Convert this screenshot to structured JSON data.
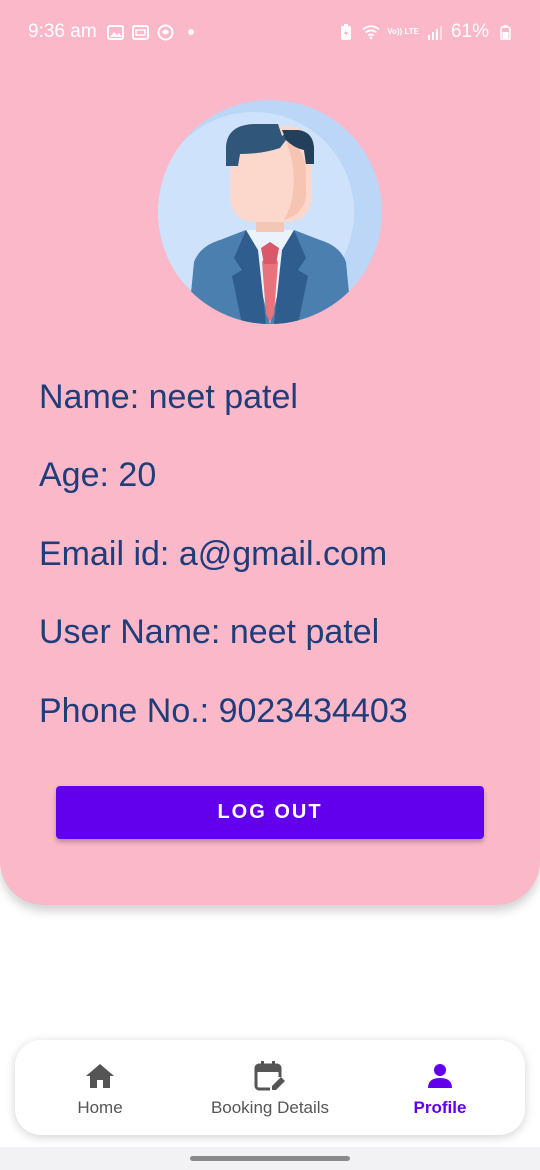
{
  "status_bar": {
    "time": "9:36 am",
    "battery": "61%",
    "network_label": "Vo)) LTE",
    "icons": [
      "gallery-icon",
      "cast-icon",
      "app-icon",
      "dot-icon",
      "battery-saver-icon",
      "wifi-icon",
      "signal-icon",
      "battery-icon"
    ]
  },
  "profile": {
    "avatar_icon": "businessman-avatar-icon",
    "name_label": "Name:",
    "name_value": "neet patel",
    "age_label": "Age:",
    "age_value": "20",
    "email_label": "Email id:",
    "email_value": "a@gmail.com",
    "username_label": "User Name:",
    "username_value": "neet patel",
    "phone_label": "Phone No.:",
    "phone_value": "9023434403",
    "logout_label": "LOG OUT"
  },
  "bottom_nav": {
    "items": [
      {
        "label": "Home",
        "icon": "home-icon",
        "active": false
      },
      {
        "label": "Booking Details",
        "icon": "calendar-edit-icon",
        "active": false
      },
      {
        "label": "Profile",
        "icon": "person-icon",
        "active": true
      }
    ]
  },
  "colors": {
    "card_background": "#fbb8c9",
    "text_primary": "#1f3d7a",
    "accent": "#6200ee",
    "nav_inactive": "#555555"
  }
}
